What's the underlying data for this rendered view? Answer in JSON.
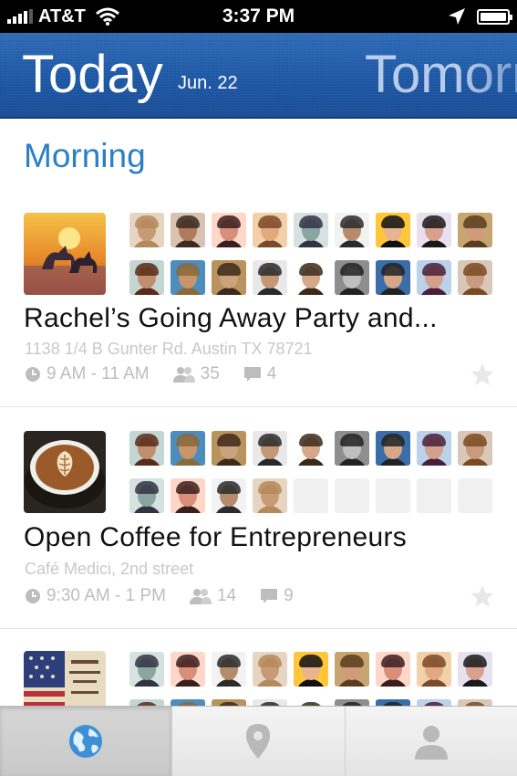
{
  "status_bar": {
    "carrier": "AT&T",
    "time": "3:37 PM"
  },
  "header": {
    "title": "Today",
    "date": "Jun. 22",
    "next_title": "Tomorrow"
  },
  "section": {
    "title": "Morning"
  },
  "events": [
    {
      "title": "Rachel’s Going Away Party and...",
      "address": "1138 1/4 B Gunter Rd. Austin TX 78721",
      "time": "9 AM - 11 AM",
      "attendees": "35",
      "comments": "4",
      "thumb": "unicorn-painting",
      "avatars": [
        [
          "#e7d5c4",
          "#c89a76",
          "#b48a5a"
        ],
        [
          "#d9c2b0",
          "#b07a5c",
          "#3a2a22"
        ],
        [
          "#ffd7c8",
          "#d88f7a",
          "#3b1f1f"
        ],
        [
          "#f2d0a8",
          "#e2a980",
          "#7a4a2a"
        ],
        [
          "#d6e2e0",
          "#8aa5a0",
          "#334"
        ],
        [
          "#f2f2f2",
          "#b58b6b",
          "#2b2b2b"
        ],
        [
          "#ffc63a",
          "#e9b48f",
          "#111"
        ],
        [
          "#e8e0ef",
          "#d7a18e",
          "#1a1a1a"
        ],
        [
          "#c6a570",
          "#d19a7a",
          "#5a3c1e"
        ],
        [
          "#c4d6d2",
          "#c18e6f",
          "#5a2a1a"
        ],
        [
          "#4c8dbe",
          "#c9956a",
          "#8b6a3a"
        ],
        [
          "#b9935d",
          "#caa27c",
          "#3d2a1a"
        ],
        [
          "#e8e8e8",
          "#c49876",
          "#2a2a2a"
        ],
        [
          "#ffffff",
          "#d7a78a",
          "#3a2a1a"
        ],
        [
          "#8e8e8e",
          "#bfbfbf",
          "#222"
        ],
        [
          "#3b6ea8",
          "#d7a789",
          "#222"
        ],
        [
          "#bcd2ea",
          "#d3a08c",
          "#4a1e3a"
        ],
        [
          "#d9c8b8",
          "#c89a7e",
          "#7a4a20"
        ]
      ]
    },
    {
      "title": "Open Coffee for Entrepreneurs",
      "address": "Café Medici, 2nd street",
      "time": "9:30 AM - 1 PM",
      "attendees": "14",
      "comments": "9",
      "thumb": "latte-art",
      "avatars": [
        [
          "#c4d6d2",
          "#c18e6f",
          "#5a2a1a"
        ],
        [
          "#4c8dbe",
          "#c9956a",
          "#8b6a3a"
        ],
        [
          "#b9935d",
          "#caa27c",
          "#3d2a1a"
        ],
        [
          "#e8e8e8",
          "#c49876",
          "#2a2a2a"
        ],
        [
          "#ffffff",
          "#d7a78a",
          "#3a2a1a"
        ],
        [
          "#8e8e8e",
          "#bfbfbf",
          "#222"
        ],
        [
          "#3b6ea8",
          "#d7a789",
          "#222"
        ],
        [
          "#bcd2ea",
          "#d3a08c",
          "#4a1e3a"
        ],
        [
          "#d9c8b8",
          "#c89a7e",
          "#7a4a20"
        ],
        [
          "#d6e2e0",
          "#8aa5a0",
          "#334"
        ],
        [
          "#ffd7c8",
          "#d88f7a",
          "#3b1f1f"
        ],
        [
          "#f2f2f2",
          "#b58b6b",
          "#2b2b2b"
        ],
        [
          "#e7d5c4",
          "#c89a76",
          "#b48a5a"
        ],
        null,
        null,
        null,
        null,
        null
      ]
    },
    {
      "title": "",
      "address": "",
      "time": "",
      "attendees": "",
      "comments": "",
      "thumb": "fourth-of-july-poster",
      "avatars": [
        [
          "#d6e2e0",
          "#8aa5a0",
          "#334"
        ],
        [
          "#ffd7c8",
          "#d88f7a",
          "#3b1f1f"
        ],
        [
          "#f2f2f2",
          "#b58b6b",
          "#2b2b2b"
        ],
        [
          "#e7d5c4",
          "#c89a76",
          "#b48a5a"
        ],
        [
          "#ffc63a",
          "#e9b48f",
          "#111"
        ],
        [
          "#c6a570",
          "#d19a7a",
          "#5a3c1e"
        ],
        [
          "#ffd7c8",
          "#d88f7a",
          "#3b1f1f"
        ],
        [
          "#f2d0a8",
          "#e2a980",
          "#7a4a2a"
        ],
        [
          "#e8e0ef",
          "#d7a18e",
          "#1a1a1a"
        ],
        [
          "#c4d6d2",
          "#c18e6f",
          "#5a2a1a"
        ],
        [
          "#4c8dbe",
          "#c9956a",
          "#8b6a3a"
        ],
        [
          "#b9935d",
          "#caa27c",
          "#3d2a1a"
        ],
        [
          "#e8e8e8",
          "#c49876",
          "#2a2a2a"
        ],
        [
          "#ffffff",
          "#d7a78a",
          "#3a2a1a"
        ],
        [
          "#8e8e8e",
          "#bfbfbf",
          "#222"
        ],
        [
          "#3b6ea8",
          "#d7a789",
          "#222"
        ],
        [
          "#bcd2ea",
          "#d3a08c",
          "#4a1e3a"
        ],
        [
          "#d9c8b8",
          "#c89a7e",
          "#7a4a20"
        ]
      ]
    }
  ],
  "tabs": [
    {
      "icon": "globe-icon",
      "active": true
    },
    {
      "icon": "map-pin-icon",
      "active": false
    },
    {
      "icon": "person-icon",
      "active": false
    }
  ],
  "colors": {
    "accent": "#2a7fc6",
    "header": "#1e58a6",
    "muted": "#c8c8c8"
  }
}
